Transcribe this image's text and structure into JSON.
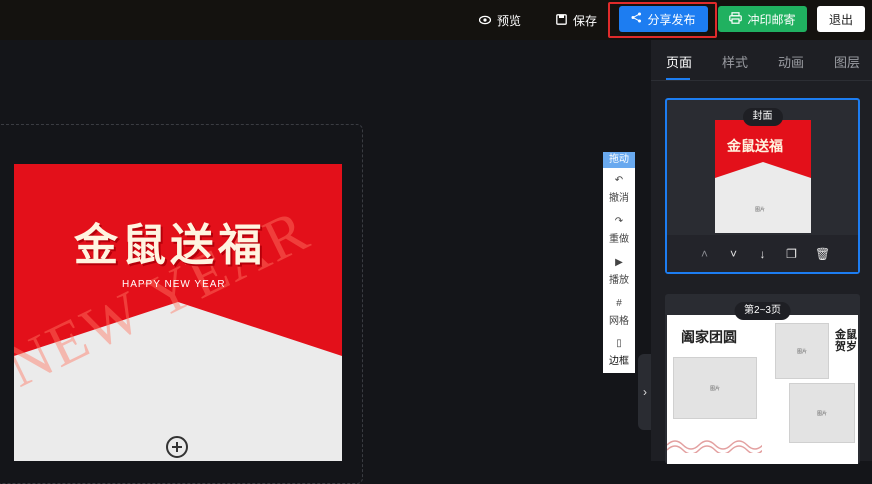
{
  "topbar": {
    "preview_label": "预览",
    "save_label": "保存",
    "share_label": "分享发布",
    "print_label": "冲印邮寄",
    "exit_label": "退出"
  },
  "canvas": {
    "page_title": "金鼠送福",
    "page_subtitle": "HAPPY NEW YEAR",
    "watermark": "NEW YEAR"
  },
  "toolstrip": {
    "drag_label": "拖动",
    "tools": [
      {
        "label": "撤消",
        "icon": "undo-icon"
      },
      {
        "label": "重做",
        "icon": "redo-icon"
      },
      {
        "label": "播放",
        "icon": "play-icon"
      },
      {
        "label": "网格",
        "icon": "grid-icon"
      },
      {
        "label": "边框",
        "icon": "frame-icon"
      }
    ]
  },
  "sidebar": {
    "tabs": [
      "页面",
      "样式",
      "动画",
      "图层"
    ],
    "active_tab": "页面",
    "thumbnails": [
      {
        "badge": "封面",
        "mini_title": "金鼠送福",
        "placeholder": "图片"
      },
      {
        "badge": "第2~3页",
        "left_title": "阖家团圆",
        "right_title": "金鼠贺岁",
        "placeholder": "图片"
      }
    ],
    "thumb_actions": [
      "chevron-up-icon",
      "chevron-down-icon",
      "arrow-down-icon",
      "copy-icon",
      "trash-icon"
    ]
  },
  "colors": {
    "primary": "#1d7df1",
    "print_green": "#20b160",
    "highlight_red": "#e02b2b",
    "cover_red": "#e3101a"
  }
}
